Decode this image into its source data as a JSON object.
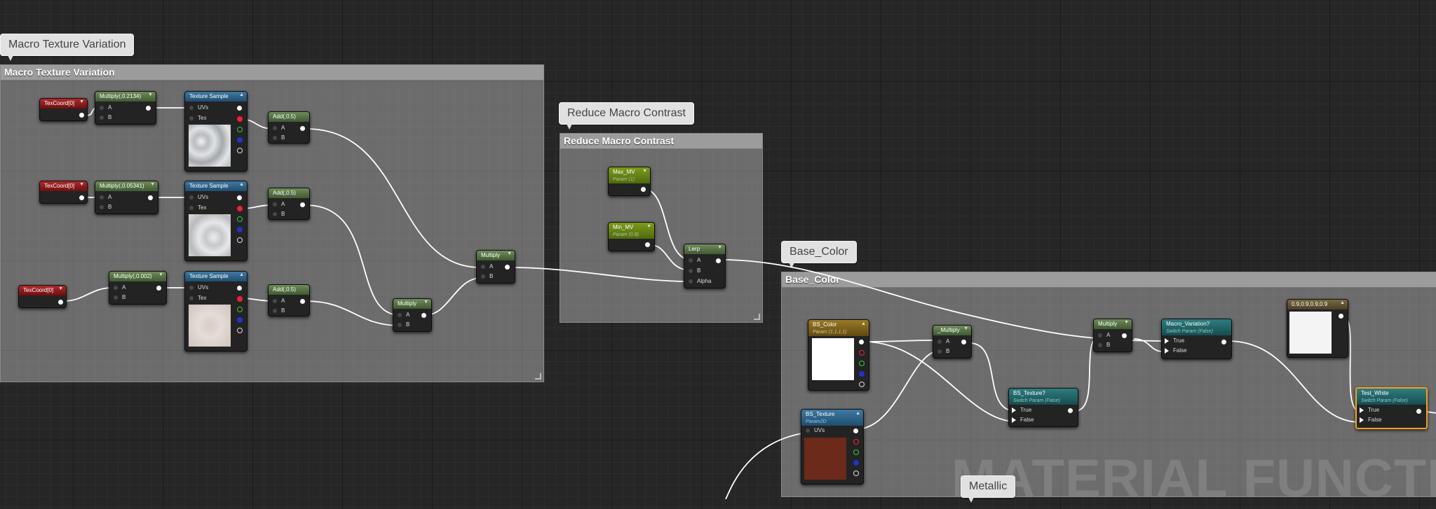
{
  "comments": {
    "macro_texture": {
      "title": "Macro Texture Variation",
      "bubble": "Macro Texture Variation"
    },
    "reduce_contrast": {
      "title": "Reduce Macro Contrast",
      "bubble": "Reduce Macro Contrast"
    },
    "base_color": {
      "title": "Base_Color",
      "bubble": "Base_Color"
    },
    "metallic": {
      "bubble": "Metallic"
    }
  },
  "nodes": {
    "texcoord_1": {
      "title": "TexCoord[0]"
    },
    "texcoord_2": {
      "title": "TexCoord[0]"
    },
    "texcoord_3": {
      "title": "TexCoord[0]"
    },
    "multiply_1": {
      "title": "Multiply(,0.2134)",
      "pin_a": "A",
      "pin_b": "B"
    },
    "multiply_2": {
      "title": "Multiply(,0.05341)",
      "pin_a": "A",
      "pin_b": "B"
    },
    "multiply_3": {
      "title": "Multiply(,0.002)",
      "pin_a": "A",
      "pin_b": "B"
    },
    "texture_sample_1": {
      "title": "Texture Sample",
      "pin_uvs": "UVs",
      "pin_tex": "Tex"
    },
    "texture_sample_2": {
      "title": "Texture Sample",
      "pin_uvs": "UVs",
      "pin_tex": "Tex"
    },
    "texture_sample_3": {
      "title": "Texture Sample",
      "pin_uvs": "UVs",
      "pin_tex": "Tex"
    },
    "add_1": {
      "title": "Add(,0.5)",
      "pin_a": "A",
      "pin_b": "B"
    },
    "add_2": {
      "title": "Add(,0.5)",
      "pin_a": "A",
      "pin_b": "B"
    },
    "add_3": {
      "title": "Add(,0.5)",
      "pin_a": "A",
      "pin_b": "B"
    },
    "multiply_4": {
      "title": "Multiply",
      "pin_a": "A",
      "pin_b": "B"
    },
    "multiply_5": {
      "title": "Multiply",
      "pin_a": "A",
      "pin_b": "B"
    },
    "max_mv": {
      "title": "Max_MV",
      "subtitle": "Param (1)"
    },
    "min_mv": {
      "title": "Min_MV",
      "subtitle": "Param (0.8)"
    },
    "lerp": {
      "title": "Lerp",
      "pin_a": "A",
      "pin_b": "B",
      "pin_alpha": "Alpha"
    },
    "bs_color": {
      "title": "BS_Color",
      "subtitle": "Param (1,1,1,1)"
    },
    "multiply_6": {
      "title": "_Multiply",
      "pin_a": "A",
      "pin_b": "B"
    },
    "multiply_7": {
      "title": "Multiply",
      "pin_a": "A",
      "pin_b": "B"
    },
    "bs_texture_switch": {
      "title": "BS_Texture?",
      "subtitle": "Switch Param (False)",
      "pin_true": "True",
      "pin_false": "False"
    },
    "macro_variation": {
      "title": "Macro_Variation?",
      "subtitle": "Switch Param (False)",
      "pin_true": "True",
      "pin_false": "False"
    },
    "bs_texture": {
      "title": "BS_Texture",
      "subtitle": "Param2D",
      "pin_uvs": "UVs"
    },
    "constant_white": {
      "title": "0.9,0.9,0.9,0.9"
    },
    "test_white": {
      "title": "Test_White",
      "subtitle": "Switch Param (False)",
      "pin_true": "True",
      "pin_false": "False"
    }
  },
  "watermark": "MATERIAL FUNCTION",
  "colors": {
    "selection": "#f0a21e",
    "wire": "#ffffff",
    "swatch_red_brown": "#6b2a1a"
  }
}
